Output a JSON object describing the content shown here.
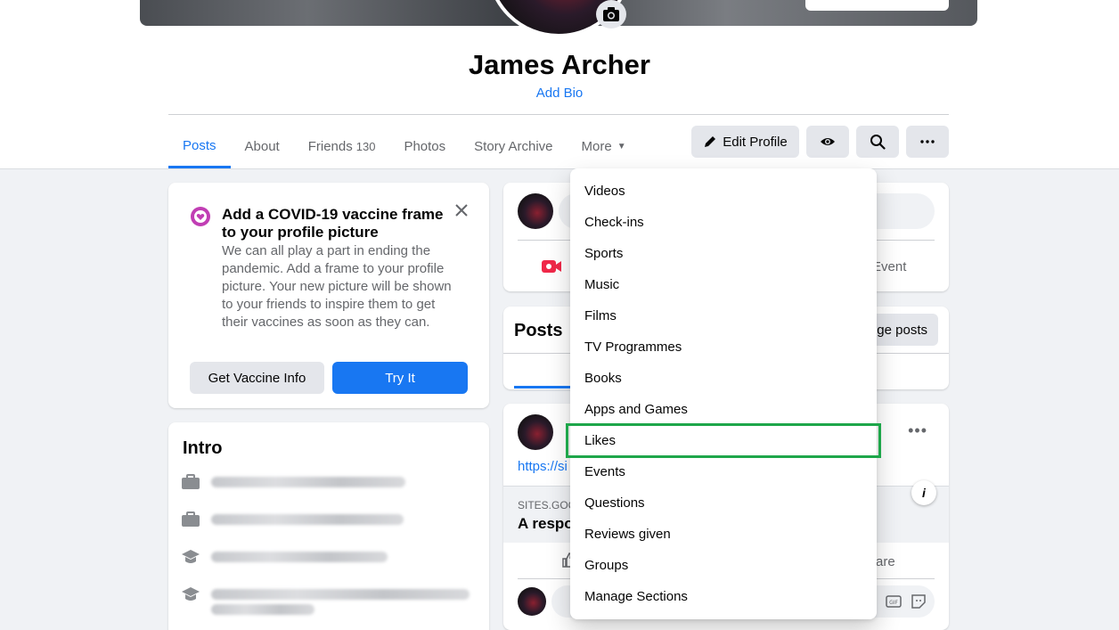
{
  "profile": {
    "name": "James Archer",
    "add_bio": "Add Bio"
  },
  "tabs": [
    {
      "label": "Posts",
      "count": ""
    },
    {
      "label": "About",
      "count": ""
    },
    {
      "label": "Friends",
      "count": "130"
    },
    {
      "label": "Photos",
      "count": ""
    },
    {
      "label": "Story Archive",
      "count": ""
    },
    {
      "label": "More",
      "count": ""
    }
  ],
  "actions": {
    "edit_profile": "Edit Profile"
  },
  "covid_card": {
    "title": "Add a COVID-19 vaccine frame to your profile picture",
    "text": "We can all play a part in ending the pandemic. Add a frame to your profile picture. Your new picture will be shown to your friends to inspire them to get their vaccines as soon as they can.",
    "vaccine_button": "Get Vaccine Info",
    "try_button": "Try It"
  },
  "intro": {
    "title": "Intro"
  },
  "create_post": {
    "event_label": "Event"
  },
  "posts_section": {
    "title": "Posts",
    "manage_label": "ge posts"
  },
  "post": {
    "link_text": "https://si",
    "link_source": "SITES.GOC",
    "link_title": "A respo",
    "share_label": "are",
    "info_glyph": "i"
  },
  "more_menu": {
    "items": [
      "Videos",
      "Check-ins",
      "Sports",
      "Music",
      "Films",
      "TV Programmes",
      "Books",
      "Apps and Games",
      "Likes",
      "Events",
      "Questions",
      "Reviews given",
      "Groups",
      "Manage Sections"
    ],
    "highlighted": "Likes"
  },
  "colors": {
    "accent": "#1877f2",
    "highlight_box": "#1ea64a",
    "background": "#f0f2f5"
  }
}
